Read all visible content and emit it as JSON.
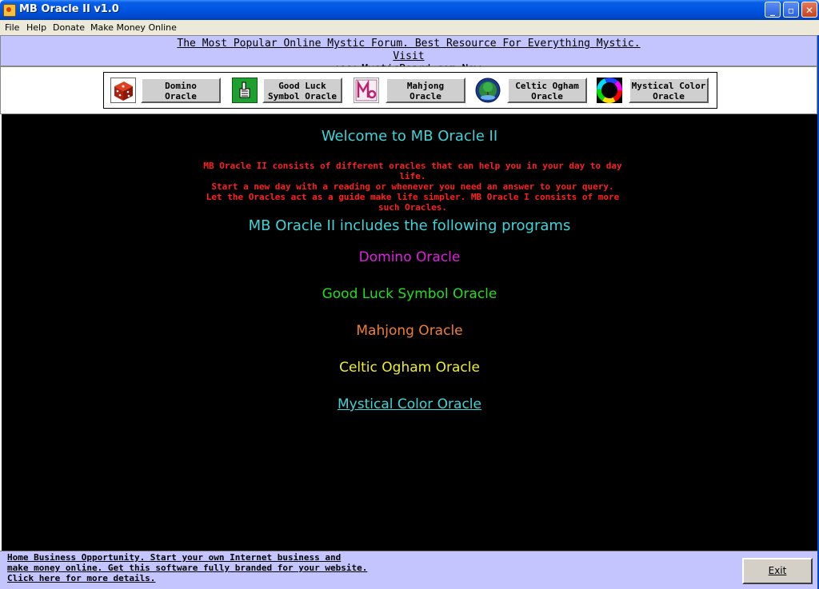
{
  "window": {
    "title": "MB Oracle II v1.0",
    "controls": [
      "minimize",
      "maximize",
      "close"
    ]
  },
  "menu": [
    "File",
    "Help",
    "Donate",
    "Make Money Online"
  ],
  "banner": {
    "line1": "The Most Popular Online Mystic Forum. Best Resource For Everything Mystic. Visit",
    "line2": "www.MysticBoard.com Now"
  },
  "toolbar": [
    {
      "icon": "dice-icon",
      "line1": "Domino",
      "line2": "Oracle"
    },
    {
      "icon": "thumbs-up-icon",
      "line1": "Good Luck",
      "line2": "Symbol Oracle"
    },
    {
      "icon": "mahjong-tile-icon",
      "line1": "Mahjong",
      "line2": "Oracle"
    },
    {
      "icon": "tree-globe-icon",
      "line1": "Celtic Ogham",
      "line2": "Oracle"
    },
    {
      "icon": "color-wheel-icon",
      "line1": "Mystical Color",
      "line2": "Oracle"
    }
  ],
  "content": {
    "welcome": "Welcome to MB Oracle II",
    "description": [
      "MB Oracle II consists of different oracles that can help you in your day to day life.",
      "Start a new day with a reading or whenever you need an answer to your query.",
      "Let the Oracles act as a guide make life simpler. MB Oracle I consists of more",
      "such Oracles."
    ],
    "includes": "MB Oracle II includes the following programs",
    "programs": [
      {
        "label": "Domino Oracle",
        "color": "#e020e0"
      },
      {
        "label": "Good Luck Symbol Oracle",
        "color": "#22dd22"
      },
      {
        "label": "Mahjong Oracle",
        "color": "#f08030"
      },
      {
        "label": "Celtic Ogham Oracle",
        "color": "#f0f020"
      },
      {
        "label": "Mystical Color Oracle",
        "color": "#3fd4d9"
      }
    ]
  },
  "footer": {
    "lines": [
      "Home Business Opportunity. Start your own Internet business and",
      "make money online. Get this software fully branded for your website.",
      "Click here for more details."
    ],
    "exit_label": "Exit"
  },
  "colors": {
    "banner_bg": "#c4c4ff",
    "content_bg": "#000000",
    "cyan_text": "#3fd4d9",
    "red_text": "#ff2020"
  }
}
